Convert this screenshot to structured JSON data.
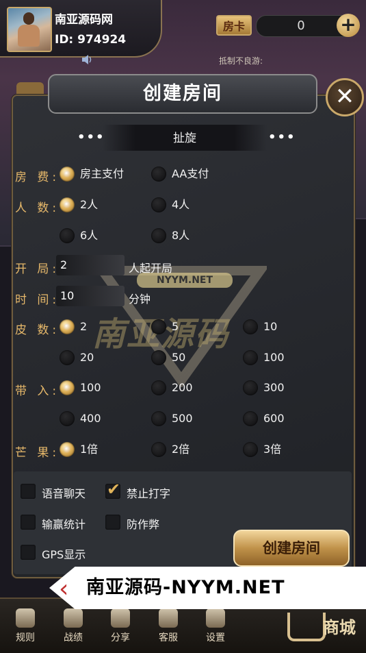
{
  "header": {
    "nickname": "南亚源码网",
    "user_id": "ID: 974924",
    "card_label": "房卡",
    "card_count": "0",
    "add_label": "+",
    "marquee": "抵制不良游:"
  },
  "dialog": {
    "title": "创建房间",
    "close_label": "✕",
    "mode_label": "扯旋",
    "dots": "•••",
    "rows": {
      "fee": {
        "label": "房 费:",
        "options": [
          "房主支付",
          "AA支付"
        ],
        "selected": 0
      },
      "players": {
        "label": "人 数:",
        "options": [
          "2人",
          "4人",
          "6人",
          "8人"
        ],
        "selected": 0
      },
      "start": {
        "label": "开 局:",
        "value": "2",
        "unit": "人起开局"
      },
      "time": {
        "label": "时 间:",
        "value": "10",
        "unit": "分钟"
      },
      "skin": {
        "label": "皮 数:",
        "options": [
          "2",
          "5",
          "10",
          "20",
          "50",
          "100"
        ],
        "selected": 0
      },
      "buyin": {
        "label": "带 入:",
        "options": [
          "100",
          "200",
          "300",
          "400",
          "500",
          "600"
        ],
        "selected": 0
      },
      "mango": {
        "label": "芒 果:",
        "options": [
          "1倍",
          "2倍",
          "3倍"
        ],
        "selected": 0
      }
    },
    "checks": {
      "voice": {
        "label": "语音聊天",
        "checked": false
      },
      "no_typing": {
        "label": "禁止打字",
        "checked": true
      },
      "stats": {
        "label": "输赢统计",
        "checked": false
      },
      "anticheat": {
        "label": "防作弊",
        "checked": false
      },
      "gps": {
        "label": "GPS显示",
        "checked": false
      }
    },
    "create_label": "创建房间"
  },
  "watermark": {
    "url": "NYYM.NET",
    "text": "南亚源码"
  },
  "banner": {
    "text": "南亚源码-NYYM.NET"
  },
  "bottom_nav": {
    "rules": "规则",
    "record": "战绩",
    "share": "分享",
    "service": "客服",
    "settings": "设置",
    "shop": "商城"
  }
}
